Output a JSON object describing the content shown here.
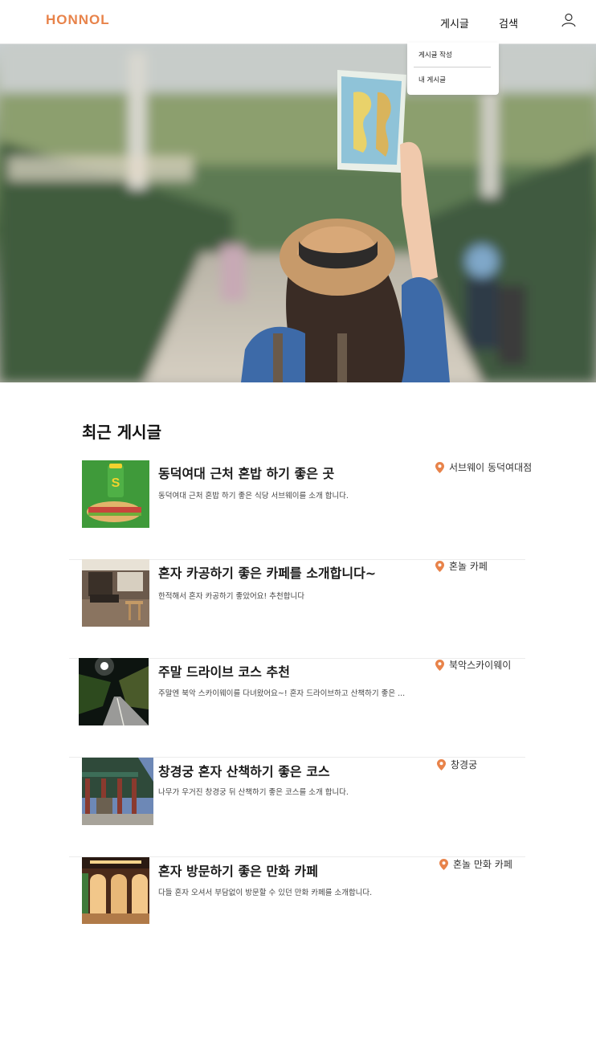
{
  "header": {
    "logo": "HONNOL",
    "nav": [
      {
        "label": "게시글"
      },
      {
        "label": "검색"
      }
    ],
    "user_icon": "user-icon"
  },
  "dropdown": {
    "items": [
      {
        "label": "게시글 작성"
      },
      {
        "label": "내 게시글"
      }
    ]
  },
  "hero": {
    "image": "traveler-holding-map-photo"
  },
  "recent": {
    "title": "최근 게시글",
    "posts": [
      {
        "title": "동덕여대 근처 혼밥 하기 좋은 곳",
        "desc": "동덕여대 근처 혼밥 하기 좋은 식당 서브웨이를 소개 합니다.",
        "location": "서브웨이 동덕여대점",
        "thumb": "subway-sandwich-photo"
      },
      {
        "title": "혼자 카공하기 좋은 카페를 소개합니다~",
        "desc": "한적해서 혼자 카공하기 좋았어요! 추천합니다",
        "location": "혼놀 카페",
        "thumb": "cafe-interior-photo"
      },
      {
        "title": "주말 드라이브 코스 추천",
        "desc": "주말엔 북악 스카이웨이를 다녀왔어요~! 혼자 드라이브하고 산책하기 좋은  ...",
        "location": "북악스카이웨이",
        "thumb": "night-road-photo"
      },
      {
        "title": "창경궁 혼자 산책하기 좋은 코스",
        "desc": "나무가 우거진 창경궁 뒤 산책하기 좋은 코스를 소개 합니다.",
        "location": "창경궁",
        "thumb": "palace-photo"
      },
      {
        "title": "혼자 방문하기 좋은 만화 카페",
        "desc": "다들 혼자 오셔서 부담없이 방문할 수 있던 만화 카페를 소개합니다.",
        "location": "혼놀 만화 카페",
        "thumb": "manga-cafe-photo"
      }
    ]
  },
  "colors": {
    "accent": "#e8834a",
    "pin": "#e8834a"
  }
}
